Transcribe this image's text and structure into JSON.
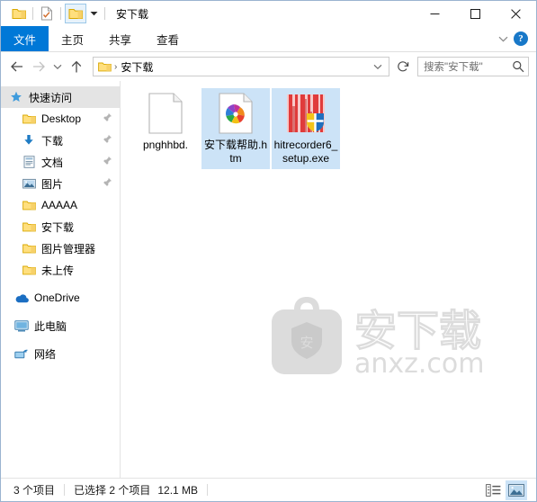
{
  "window": {
    "title": "安下载",
    "quick_access_icons": [
      "folder-icon",
      "properties-icon",
      "new-folder-icon"
    ],
    "dropdown_icon": "chevron-down-icon",
    "controls": {
      "minimize": "minimize-icon",
      "maximize": "maximize-icon",
      "close": "close-icon"
    }
  },
  "ribbon": {
    "tabs": [
      {
        "label": "文件",
        "active": true
      },
      {
        "label": "主页",
        "active": false
      },
      {
        "label": "共享",
        "active": false
      },
      {
        "label": "查看",
        "active": false
      }
    ],
    "collapse_icon": "chevron-down-icon",
    "help_icon": "help-icon",
    "help_label": "?"
  },
  "navbar": {
    "back_icon": "arrow-left-icon",
    "forward_icon": "arrow-right-icon",
    "history_icon": "chevron-down-icon",
    "up_icon": "arrow-up-icon",
    "breadcrumb": {
      "folder_icon": "folder-icon",
      "separator": "›",
      "path": "安下载"
    },
    "address_chevron_icon": "chevron-down-icon",
    "refresh_icon": "refresh-icon",
    "search": {
      "placeholder": "搜索\"安下载\"",
      "icon": "search-icon"
    }
  },
  "sidebar": {
    "items": [
      {
        "label": "快速访问",
        "icon": "star-icon",
        "selected": true,
        "pinned": false,
        "indent": false
      },
      {
        "label": "Desktop",
        "icon": "folder-icon",
        "selected": false,
        "pinned": true,
        "indent": true
      },
      {
        "label": "下载",
        "icon": "download-icon",
        "selected": false,
        "pinned": true,
        "indent": true
      },
      {
        "label": "文档",
        "icon": "document-icon",
        "selected": false,
        "pinned": true,
        "indent": true
      },
      {
        "label": "图片",
        "icon": "pictures-icon",
        "selected": false,
        "pinned": true,
        "indent": true
      },
      {
        "label": "AAAAA",
        "icon": "folder-icon",
        "selected": false,
        "pinned": false,
        "indent": true
      },
      {
        "label": "安下载",
        "icon": "folder-icon",
        "selected": false,
        "pinned": false,
        "indent": true
      },
      {
        "label": "图片管理器",
        "icon": "folder-icon",
        "selected": false,
        "pinned": false,
        "indent": true
      },
      {
        "label": "未上传",
        "icon": "folder-icon",
        "selected": false,
        "pinned": false,
        "indent": true
      }
    ],
    "roots": [
      {
        "label": "OneDrive",
        "icon": "onedrive-icon"
      },
      {
        "label": "此电脑",
        "icon": "computer-icon"
      },
      {
        "label": "网络",
        "icon": "network-icon"
      }
    ],
    "pin_icon": "pin-icon"
  },
  "files": [
    {
      "name": "pnghhbd.",
      "icon": "blank-document-icon",
      "selected": false
    },
    {
      "name": "安下载帮助.htm",
      "icon": "html-pinwheel-icon",
      "selected": true
    },
    {
      "name": "hitrecorder6_setup.exe",
      "icon": "installer-shield-icon",
      "selected": true
    }
  ],
  "watermark": {
    "brand_cn": "安下载",
    "brand_url": "anxz.com",
    "badge_char": "安"
  },
  "statusbar": {
    "item_count": "3 个项目",
    "selection": "已选择 2 个项目",
    "selection_size": "12.1 MB",
    "views": [
      {
        "name": "details-view",
        "active": false
      },
      {
        "name": "large-icons-view",
        "active": true
      }
    ]
  },
  "colors": {
    "accent": "#0078d7",
    "selection": "#cce3f7",
    "folder_yellow": "#ffd966",
    "help_blue": "#1878c8"
  }
}
